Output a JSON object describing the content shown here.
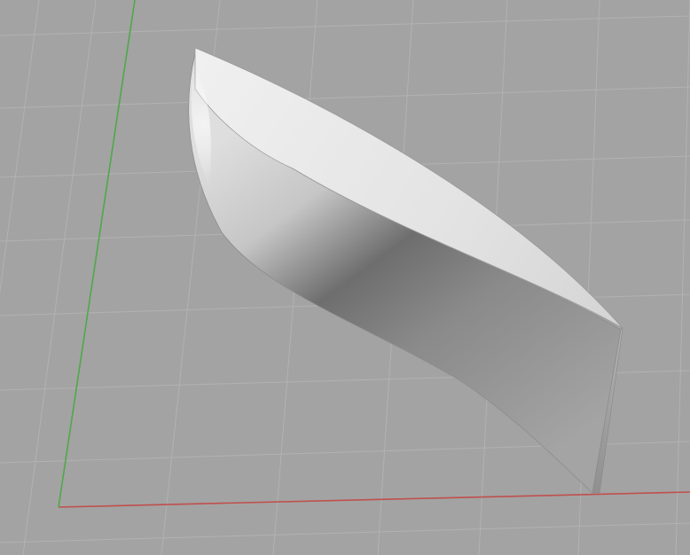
{
  "viewport": {
    "background_color": "#a3a3a3",
    "grid_line_color": "#b2b2b2",
    "x_axis_color": "#c0504d",
    "y_axis_color": "#4fa84a"
  },
  "model": {
    "kind": "curved-hull-surface",
    "light_face_color": "#e4e4e4",
    "side_light_color": "#dcdcdc",
    "side_dark_color": "#5e5e5e",
    "end_face_color": "#9c9c9c",
    "edge_color": "#8d8d8d"
  }
}
